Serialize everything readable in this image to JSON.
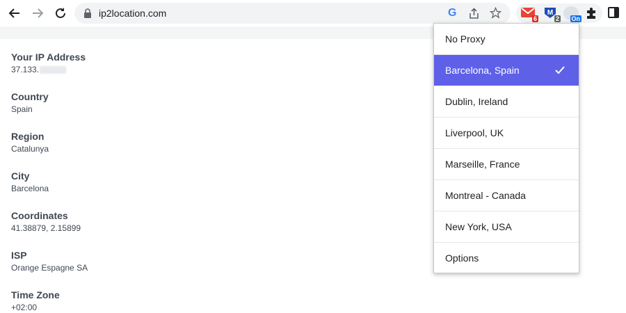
{
  "browser": {
    "url": "ip2location.com",
    "extensions": [
      {
        "name": "gmail-ext",
        "badge": "6",
        "badge_color": "#d93025"
      },
      {
        "name": "m-ext",
        "badge": "2",
        "badge_color": "#5f6368"
      },
      {
        "name": "proxy-ext",
        "badge": "On",
        "badge_color": "#1a73e8"
      }
    ]
  },
  "page": {
    "fields": [
      {
        "label": "Your IP Address",
        "value": "37.133."
      },
      {
        "label": "Country",
        "value": "Spain"
      },
      {
        "label": "Region",
        "value": "Catalunya"
      },
      {
        "label": "City",
        "value": "Barcelona"
      },
      {
        "label": "Coordinates",
        "value": "41.38879, 2.15899"
      },
      {
        "label": "ISP",
        "value": "Orange Espagne SA"
      },
      {
        "label": "Time Zone",
        "value": "+02:00"
      }
    ]
  },
  "proxy_menu": {
    "selected_color": "#5e60e8",
    "items": [
      {
        "label": "No Proxy"
      },
      {
        "label": "Barcelona, Spain",
        "selected": true
      },
      {
        "label": "Dublin, Ireland"
      },
      {
        "label": "Liverpool, UK"
      },
      {
        "label": "Marseille, France"
      },
      {
        "label": "Montreal - Canada"
      },
      {
        "label": "New York, USA"
      },
      {
        "label": "Options"
      }
    ]
  }
}
